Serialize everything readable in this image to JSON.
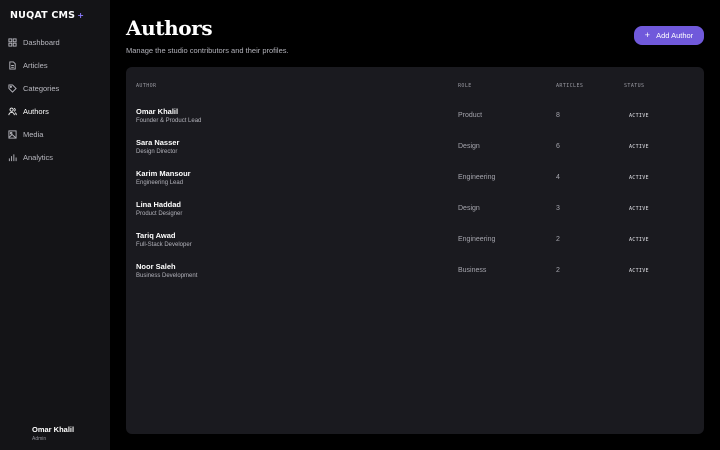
{
  "app": {
    "brand": "NUQAT CMS",
    "brand_mark": "+"
  },
  "sidebar": {
    "items": [
      {
        "label": "Dashboard",
        "icon": "grid-icon"
      },
      {
        "label": "Articles",
        "icon": "document-icon"
      },
      {
        "label": "Categories",
        "icon": "tag-icon"
      },
      {
        "label": "Authors",
        "icon": "users-icon",
        "active": true
      },
      {
        "label": "Media",
        "icon": "image-icon"
      },
      {
        "label": "Analytics",
        "icon": "bar-chart-icon"
      }
    ],
    "user": {
      "name": "Omar Khalil",
      "role": "Admin"
    }
  },
  "header": {
    "title": "Authors",
    "subtitle": "Manage the studio contributors and their profiles.",
    "add_label": "Add Author",
    "add_icon": "plus-icon"
  },
  "table": {
    "columns": {
      "author": "AUTHOR",
      "role": "ROLE",
      "articles": "ARTICLES",
      "status": "STATUS"
    },
    "rows": [
      {
        "name": "Omar Khalil",
        "title": "Founder & Product Lead",
        "role": "Product",
        "articles": "8",
        "status": "ACTIVE"
      },
      {
        "name": "Sara Nasser",
        "title": "Design Director",
        "role": "Design",
        "articles": "6",
        "status": "ACTIVE"
      },
      {
        "name": "Karim Mansour",
        "title": "Engineering Lead",
        "role": "Engineering",
        "articles": "4",
        "status": "ACTIVE"
      },
      {
        "name": "Lina Haddad",
        "title": "Product Designer",
        "role": "Design",
        "articles": "3",
        "status": "ACTIVE"
      },
      {
        "name": "Tariq Awad",
        "title": "Full-Stack Developer",
        "role": "Engineering",
        "articles": "2",
        "status": "ACTIVE"
      },
      {
        "name": "Noor Saleh",
        "title": "Business Development",
        "role": "Business",
        "articles": "2",
        "status": "ACTIVE"
      }
    ]
  },
  "colors": {
    "accent": "#7059db",
    "brand_mark": "#8d7bff",
    "card": "#1a1a1f",
    "sidebar": "#141417"
  }
}
